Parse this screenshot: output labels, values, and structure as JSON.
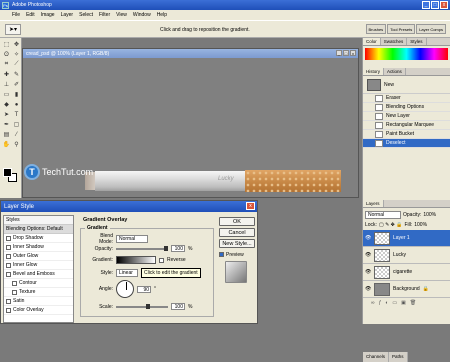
{
  "app": {
    "title": "Adobe Photoshop",
    "window_buttons": [
      "_",
      "□",
      "x"
    ]
  },
  "menu": [
    "File",
    "Edit",
    "Image",
    "Layer",
    "Select",
    "Filter",
    "View",
    "Window",
    "Help"
  ],
  "options": {
    "hint": "Click and drag to reposition the gradient.",
    "wells": [
      "Brushes",
      "Tool Presets",
      "Layer Comps"
    ]
  },
  "document": {
    "title": "cread_psd @ 100% (Layer 1, RGB/8)",
    "logo_text": "TechTut.com",
    "cig_text": "Lucky"
  },
  "right_panel": {
    "color_tabs": [
      "Color",
      "Swatches",
      "Styles"
    ],
    "history_tabs": [
      "History",
      "Actions"
    ],
    "history_snapshot": "New",
    "history_items": [
      "Eraser",
      "Blending Options",
      "New Layer",
      "Rectangular Marquee",
      "Paint Bucket",
      "Deselect"
    ],
    "layers_tabs": [
      "Layers"
    ],
    "blend_mode": "Normal",
    "opacity_label": "Opacity:",
    "opacity": "100%",
    "lock_label": "Lock:",
    "fill_label": "Fill:",
    "fill": "100%",
    "layers": [
      "Layer 1",
      "Lucky",
      "cigarette",
      "Background"
    ],
    "bottom_tabs": [
      "Channels",
      "Paths"
    ]
  },
  "dialog": {
    "title": "Layer Style",
    "styles_header": "Styles",
    "blending_header": "Blending Options: Default",
    "style_items": [
      "Drop Shadow",
      "Inner Shadow",
      "Outer Glow",
      "Inner Glow",
      "Bevel and Emboss",
      "Contour",
      "Texture",
      "Satin",
      "Color Overlay"
    ],
    "section_title": "Gradient Overlay",
    "group_title": "Gradient",
    "blend_mode_label": "Blend Mode:",
    "blend_mode": "Normal",
    "opacity_label": "Opacity:",
    "opacity": "100",
    "opacity_unit": "%",
    "gradient_label": "Gradient:",
    "reverse_label": "Reverse",
    "style_label": "Style:",
    "style": "Linear",
    "tooltip": "Click to edit the gradient",
    "angle_label": "Angle:",
    "angle": "90",
    "scale_label": "Scale:",
    "scale": "100",
    "scale_unit": "%",
    "buttons": {
      "ok": "OK",
      "cancel": "Cancel",
      "new_style": "New Style...",
      "preview": "Preview"
    }
  }
}
